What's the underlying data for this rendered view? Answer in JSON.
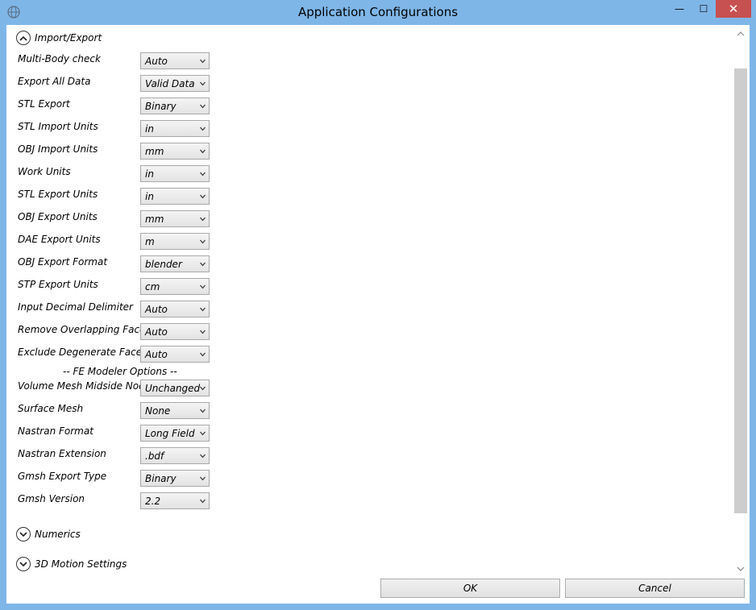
{
  "window": {
    "title": "Application Configurations",
    "minimize": "—",
    "maximize": "☐",
    "close": "✕"
  },
  "sections": {
    "import_export": "Import/Export",
    "numerics": "Numerics",
    "motion": "3D Motion Settings",
    "fe_options": "-- FE Modeler Options --"
  },
  "rows": [
    {
      "label": "Multi-Body check",
      "value": "Auto"
    },
    {
      "label": "Export All Data",
      "value": "Valid Data"
    },
    {
      "label": "STL Export",
      "value": "Binary"
    },
    {
      "label": "STL Import Units",
      "value": "in"
    },
    {
      "label": "OBJ Import Units",
      "value": "mm"
    },
    {
      "label": "Work Units",
      "value": "in"
    },
    {
      "label": "STL Export Units",
      "value": "in"
    },
    {
      "label": "OBJ Export Units",
      "value": "mm"
    },
    {
      "label": "DAE Export Units",
      "value": "m"
    },
    {
      "label": "OBJ Export Format",
      "value": "blender"
    },
    {
      "label": "STP Export Units",
      "value": "cm"
    },
    {
      "label": "Input Decimal Delimiter",
      "value": "Auto"
    },
    {
      "label": "Remove Overlapping Facets",
      "value": "Auto"
    },
    {
      "label": "Exclude Degenerate Facets",
      "value": "Auto"
    },
    {
      "label": "Volume Mesh Midside Nodes",
      "value": "Unchanged"
    },
    {
      "label": "Surface Mesh",
      "value": "None"
    },
    {
      "label": "Nastran Format",
      "value": "Long Field"
    },
    {
      "label": "Nastran Extension",
      "value": ".bdf"
    },
    {
      "label": "Gmsh Export Type",
      "value": "Binary"
    },
    {
      "label": "Gmsh Version",
      "value": "2.2"
    }
  ],
  "buttons": {
    "ok": "OK",
    "cancel": "Cancel"
  },
  "icons": {
    "app": "app-globe-icon",
    "collapse": "chevron-up-circle-icon",
    "expand": "chevron-down-circle-icon",
    "dropdown": "dropdown-arrow-icon"
  },
  "colors": {
    "titlebar": "#7fb6e8",
    "close_button": "#c75050",
    "scroll_thumb": "#cdcdcd"
  }
}
